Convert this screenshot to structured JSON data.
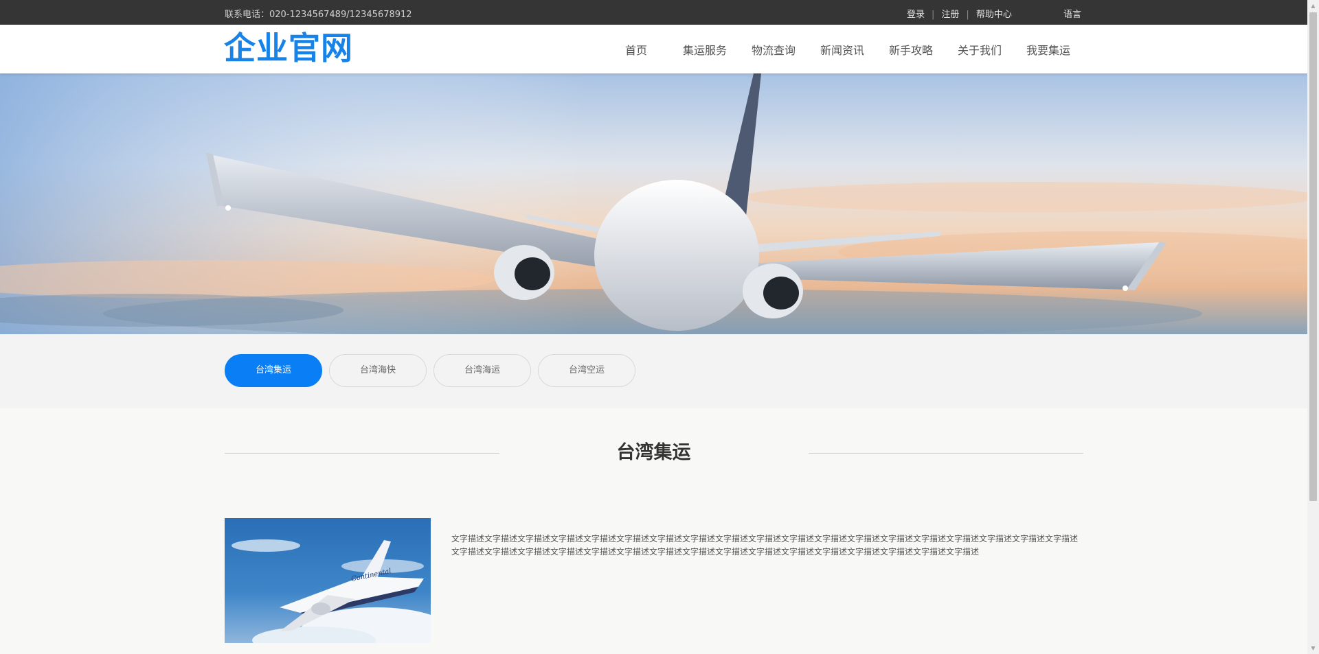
{
  "topbar": {
    "contact": "联系电话：020-1234567489/12345678912",
    "login": "登录",
    "register": "注册",
    "help": "帮助中心",
    "language": "语言",
    "separator": "|"
  },
  "header": {
    "logo": "企业官网",
    "nav": [
      "首页",
      "集运服务",
      "物流查询",
      "新闻资讯",
      "新手攻略",
      "关于我们",
      "我要集运"
    ]
  },
  "tabs": [
    {
      "label": "台湾集运",
      "active": true
    },
    {
      "label": "台湾海快",
      "active": false
    },
    {
      "label": "台湾海运",
      "active": false
    },
    {
      "label": "台湾空运",
      "active": false
    }
  ],
  "section": {
    "title": "台湾集运",
    "description": "文字描述文字描述文字描述文字描述文字描述文字描述文字描述文字描述文字描述文字描述文字描述文字描述文字描述文字描述文字描述文字描述文字描述文字描述文字描述文字描述文字描述文字描述文字描述文字描述文字描述文字描述文字描述文字描述文字描述文字描述文字描述文字描述文字描述文字描述文字描述",
    "thumb_airline_text": "Continental"
  },
  "colors": {
    "brand_blue": "#1783e8",
    "tab_active": "#0a7ff5",
    "topbar_bg": "#353535"
  }
}
